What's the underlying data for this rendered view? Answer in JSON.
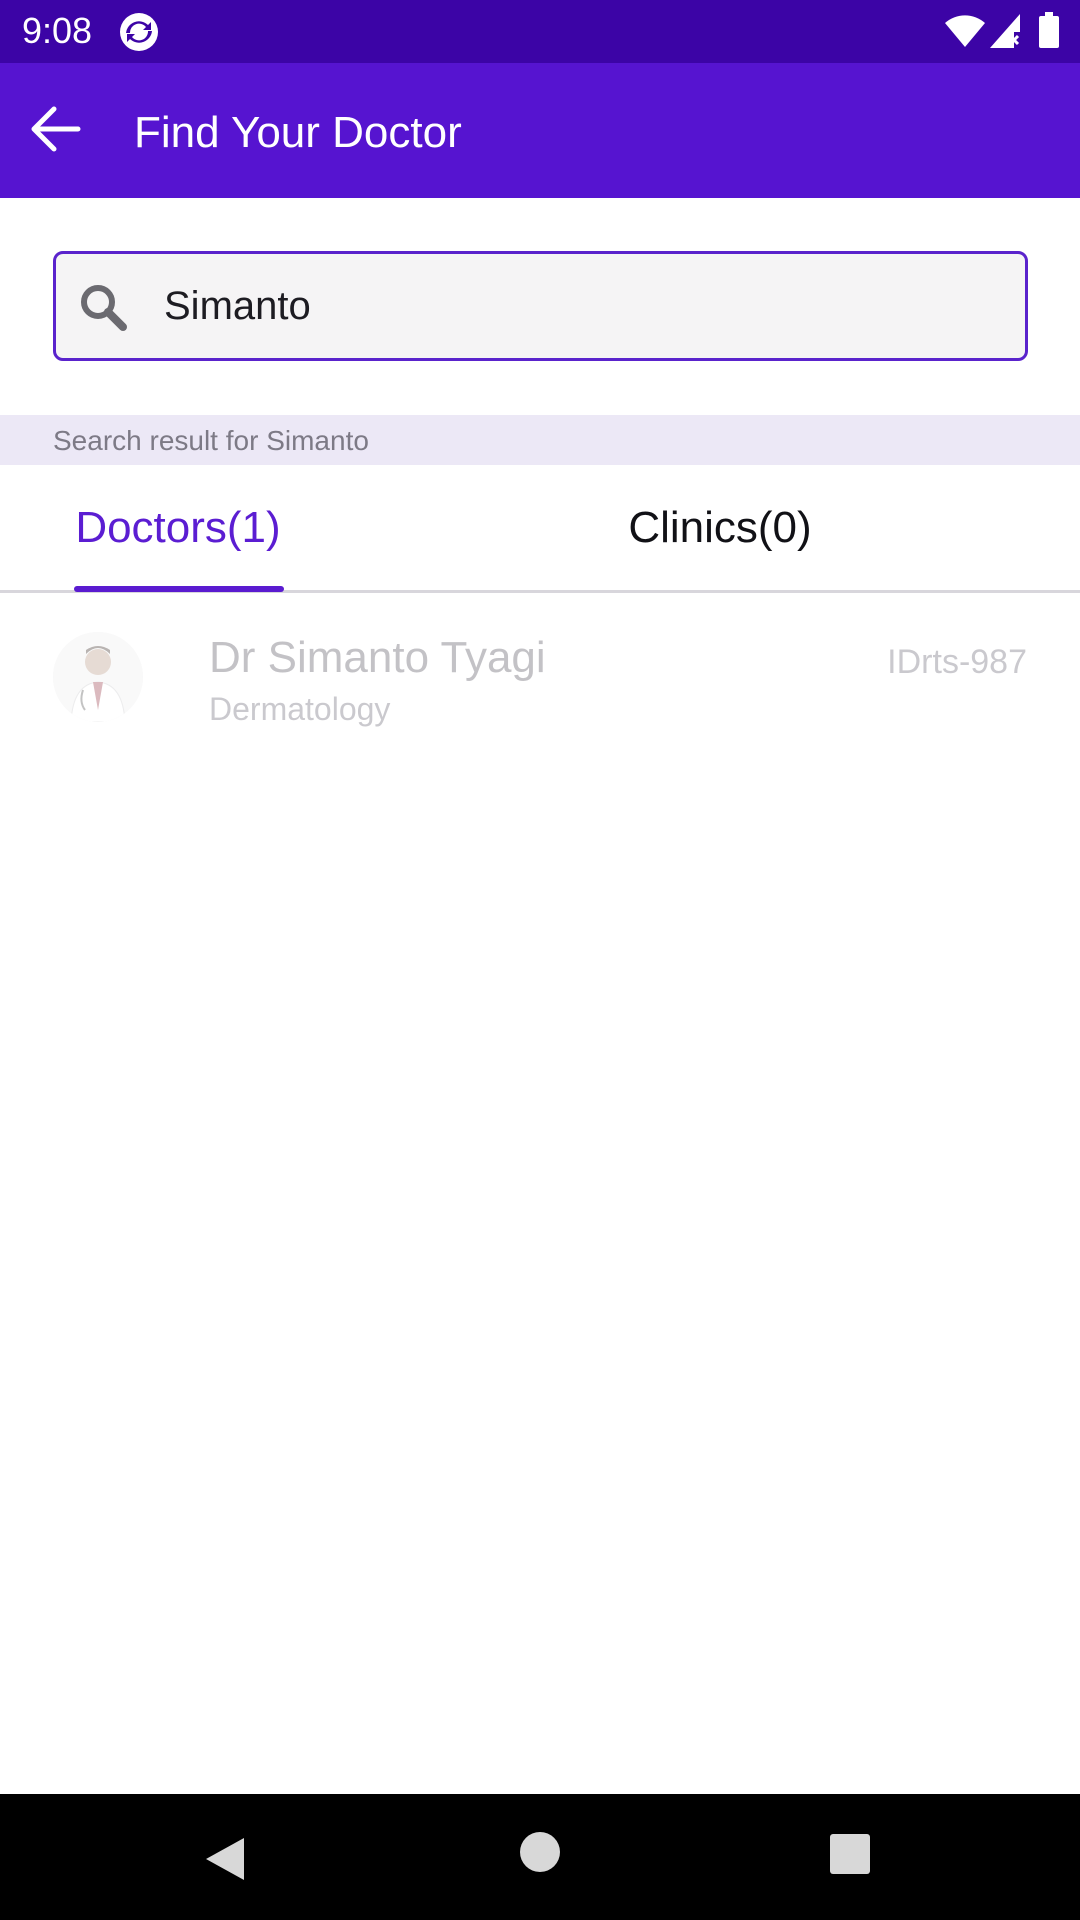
{
  "status_bar": {
    "time": "9:08",
    "icons": [
      "app-sync-icon",
      "wifi-icon",
      "signal-icon",
      "battery-icon"
    ]
  },
  "app_bar": {
    "title": "Find Your Doctor",
    "back_icon": "arrow-back-icon"
  },
  "search": {
    "value": "Simanto",
    "icon": "search-icon"
  },
  "results_banner": {
    "text": "Search result for Simanto"
  },
  "tabs": [
    {
      "label": "Doctors(1)",
      "selected": true
    },
    {
      "label": "Clinics(0)",
      "selected": false
    }
  ],
  "doctors": [
    {
      "name": "Dr Simanto Tyagi",
      "specialty": "Dermatology",
      "id": "IDrts-987"
    }
  ],
  "nav_bar": {
    "icons": [
      "nav-back-icon",
      "nav-home-icon",
      "nav-recents-icon"
    ]
  },
  "colors": {
    "status_bar": "#3c04a6",
    "app_bar": "#5614d0",
    "accent": "#5a1bd0",
    "banner": "#ece8f6"
  }
}
